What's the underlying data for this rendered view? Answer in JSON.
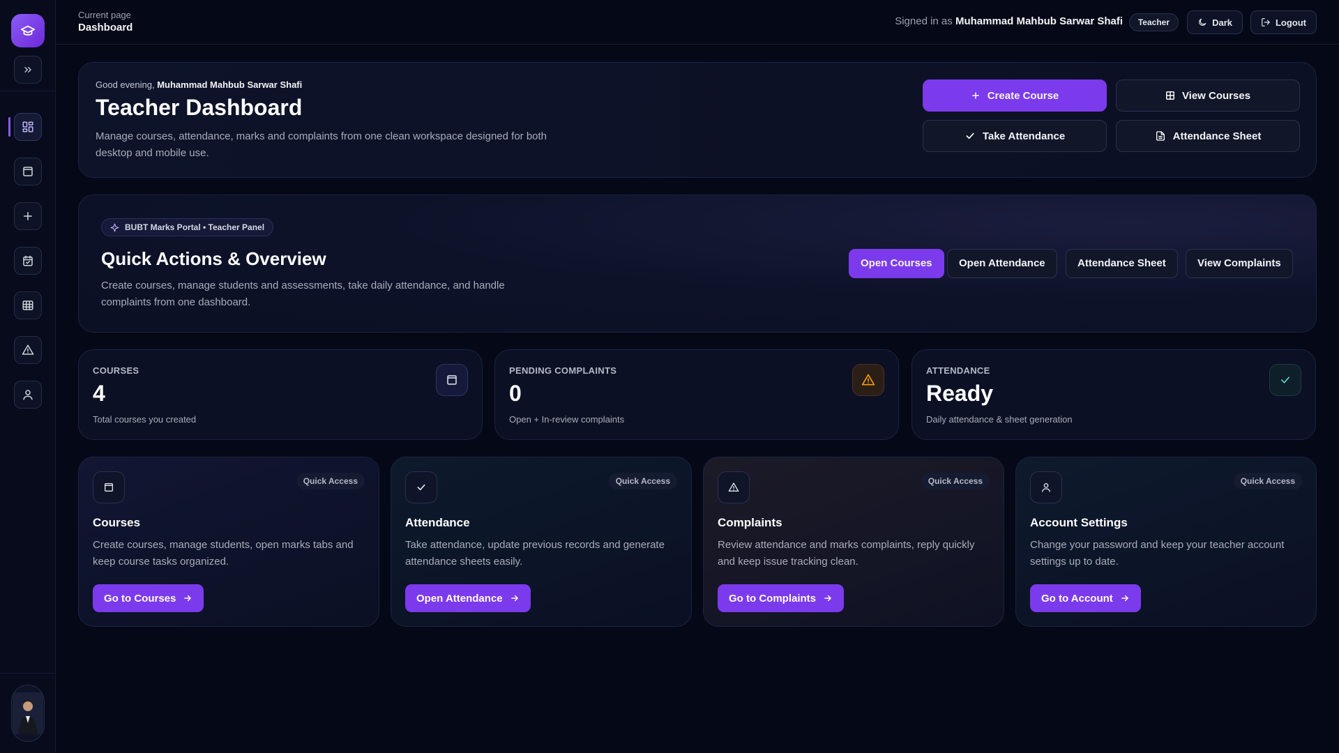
{
  "colors": {
    "accent": "#7c3aed",
    "background": "#050816",
    "warning": "#f59e0b",
    "success": "#22d3a6"
  },
  "sidebar": {
    "logo_icon": "graduation-cap-icon",
    "expand_icon": "chevrons-right-icon",
    "items": [
      {
        "name": "dashboard",
        "icon": "layout-grid-icon",
        "active": true
      },
      {
        "name": "courses",
        "icon": "book-icon"
      },
      {
        "name": "create",
        "icon": "plus-icon"
      },
      {
        "name": "attendance",
        "icon": "calendar-icon"
      },
      {
        "name": "sheet",
        "icon": "table-icon"
      },
      {
        "name": "complaints",
        "icon": "alert-triangle-icon"
      },
      {
        "name": "account",
        "icon": "user-icon"
      }
    ]
  },
  "topbar": {
    "current_page_label": "Current page",
    "current_page": "Dashboard",
    "signed_in_prefix": "Signed in as",
    "user_name": "Muhammad Mahbub Sarwar Shafi",
    "role": "Teacher",
    "theme_label": "Dark",
    "logout_label": "Logout"
  },
  "hero": {
    "greeting_prefix": "Good evening,",
    "greeting_name": "Muhammad Mahbub Sarwar Shafi",
    "title": "Teacher Dashboard",
    "description": "Manage courses, attendance, marks and complaints from one clean workspace designed for both desktop and mobile use.",
    "buttons": {
      "create_course": "Create Course",
      "view_courses": "View Courses",
      "take_attendance": "Take Attendance",
      "attendance_sheet": "Attendance Sheet"
    }
  },
  "quick": {
    "badge": "BUBT Marks Portal • Teacher Panel",
    "title": "Quick Actions & Overview",
    "description": "Create courses, manage students and assessments, take daily attendance, and handle complaints from one dashboard.",
    "buttons": [
      "Open Courses",
      "Open Attendance",
      "Attendance Sheet",
      "View Complaints"
    ]
  },
  "stats": [
    {
      "label": "COURSES",
      "value": "4",
      "sub": "Total courses you created",
      "icon": "book-icon"
    },
    {
      "label": "PENDING COMPLAINTS",
      "value": "0",
      "sub": "Open + In-review complaints",
      "icon": "alert-triangle-icon"
    },
    {
      "label": "ATTENDANCE",
      "value": "Ready",
      "sub": "Daily attendance & sheet generation",
      "icon": "check-icon"
    }
  ],
  "quick_access": [
    {
      "badge": "Quick Access",
      "title": "Courses",
      "description": "Create courses, manage students, open marks tabs and keep course tasks organized.",
      "button": "Go to Courses",
      "icon": "book-icon"
    },
    {
      "badge": "Quick Access",
      "title": "Attendance",
      "description": "Take attendance, update previous records and generate attendance sheets easily.",
      "button": "Open Attendance",
      "icon": "check-icon"
    },
    {
      "badge": "Quick Access",
      "title": "Complaints",
      "description": "Review attendance and marks complaints, reply quickly and keep issue tracking clean.",
      "button": "Go to Complaints",
      "icon": "alert-triangle-icon"
    },
    {
      "badge": "Quick Access",
      "title": "Account Settings",
      "description": "Change your password and keep your teacher account settings up to date.",
      "button": "Go to Account",
      "icon": "user-icon"
    }
  ]
}
